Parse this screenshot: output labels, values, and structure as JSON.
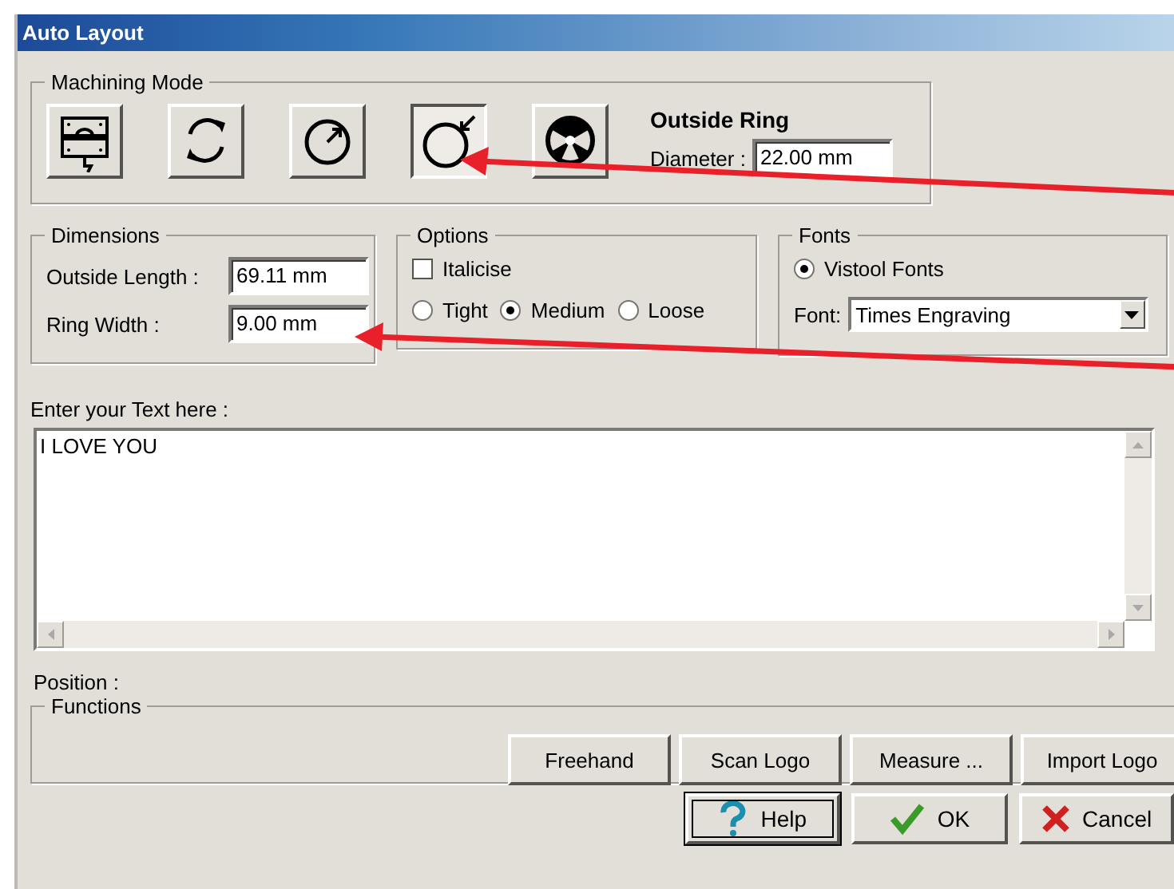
{
  "window": {
    "title": "Auto Layout"
  },
  "machining_mode": {
    "label": "Machining Mode",
    "buttons": [
      {
        "kind": "plates",
        "selected": false
      },
      {
        "kind": "loop",
        "selected": false
      },
      {
        "kind": "arrow-out",
        "selected": false
      },
      {
        "kind": "arrow-in",
        "selected": true
      },
      {
        "kind": "segments",
        "selected": false
      }
    ],
    "title": "Outside Ring",
    "diameter": {
      "label": "Diameter :",
      "value": "22.00 mm"
    }
  },
  "dimensions": {
    "label": "Dimensions",
    "fields": [
      {
        "label": "Outside Length :",
        "value": "69.11 mm"
      },
      {
        "label": "Ring Width :",
        "value": "9.00 mm"
      }
    ]
  },
  "options": {
    "label": "Options",
    "italicise": {
      "label": "Italicise",
      "checked": false
    },
    "spacing": [
      {
        "label": "Tight",
        "selected": false
      },
      {
        "label": "Medium",
        "selected": true
      },
      {
        "label": "Loose",
        "selected": false
      }
    ]
  },
  "fonts": {
    "label": "Fonts",
    "source": {
      "label": "Vistool Fonts",
      "selected": true
    },
    "font": {
      "label": "Font:",
      "value": "Times Engraving"
    }
  },
  "text_entry": {
    "label": "Enter your Text here :",
    "value": "I LOVE YOU"
  },
  "position": {
    "label": "Position :"
  },
  "functions": {
    "label": "Functions",
    "buttons": [
      "Freehand",
      "Scan Logo",
      "Measure ...",
      "Import Logo"
    ]
  },
  "dialog_buttons": [
    {
      "kind": "help",
      "label": "Help"
    },
    {
      "kind": "ok",
      "label": "OK"
    },
    {
      "kind": "cancel",
      "label": "Cancel"
    }
  ]
}
